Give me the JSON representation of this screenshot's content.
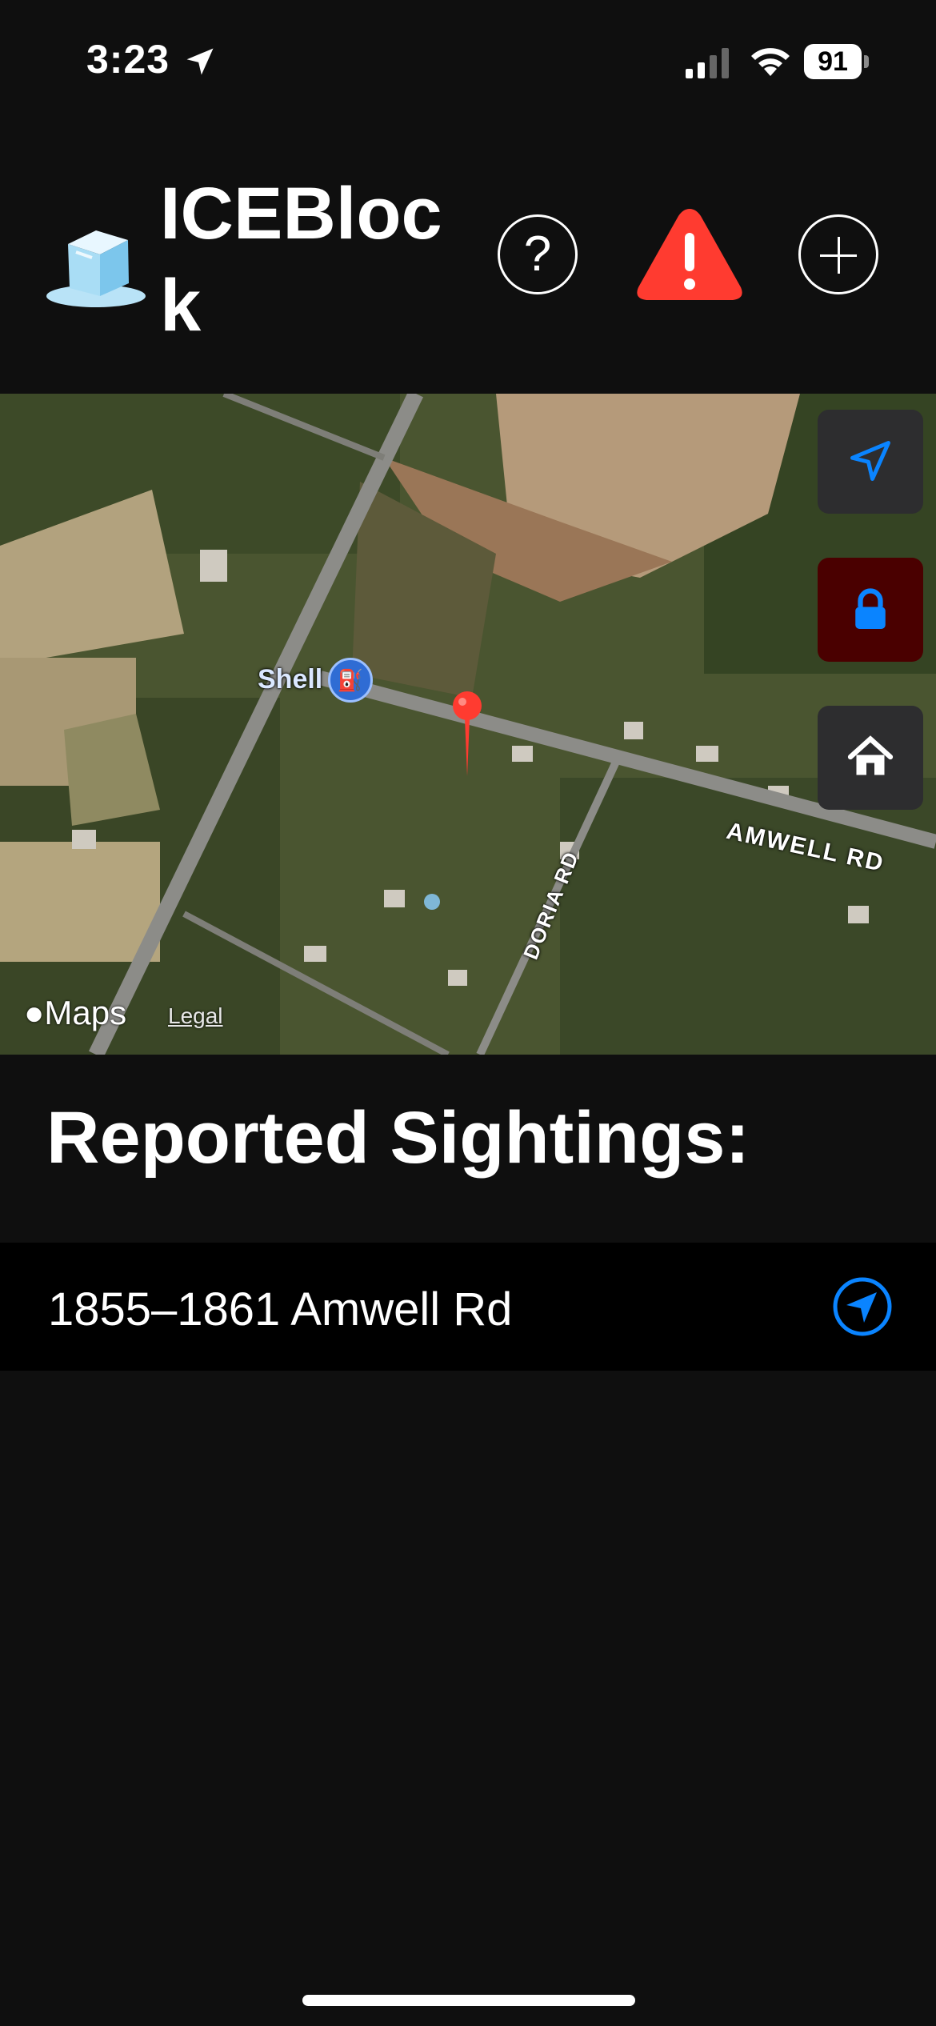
{
  "status": {
    "time": "3:23",
    "battery": "91"
  },
  "header": {
    "title": "ICEBlock",
    "help_label": "?"
  },
  "map": {
    "poi_label": "Shell",
    "road_label_1": "AMWELL RD",
    "road_label_2": "DORIA RD",
    "logo_text": "Maps",
    "legal_label": "Legal"
  },
  "sightings": {
    "title": "Reported Sightings:",
    "items": [
      {
        "address": "1855–1861 Amwell Rd"
      }
    ]
  },
  "icons": {
    "status_location": "location-arrow-icon",
    "alert": "warning-triangle-icon",
    "add": "plus-circle-icon",
    "help": "question-circle-icon",
    "locate": "location-arrow-icon",
    "lock": "lock-icon",
    "home": "house-icon",
    "row_navigate": "navigation-circle-icon"
  },
  "colors": {
    "alert": "#ff3b30",
    "accent": "#0a84ff",
    "lock_bg": "#4a0000",
    "pin": "#ff3b30"
  }
}
